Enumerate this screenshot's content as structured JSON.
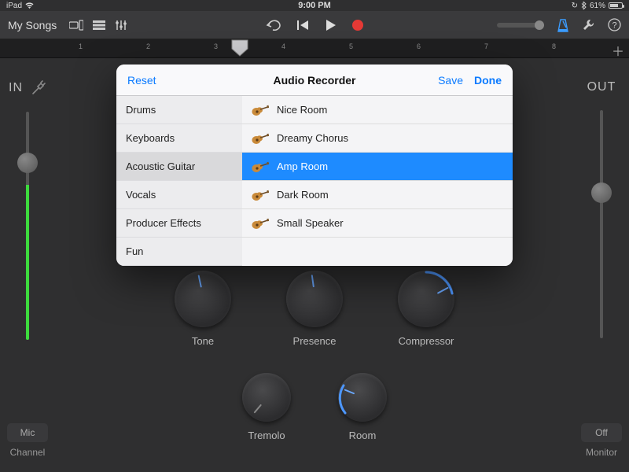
{
  "status": {
    "device": "iPad",
    "time": "9:00 PM",
    "battery_pct": "61%"
  },
  "topbar": {
    "my_songs": "My Songs"
  },
  "ruler": {
    "numbers": [
      1,
      2,
      3,
      4,
      5,
      6,
      7,
      8
    ]
  },
  "sides": {
    "in": {
      "label": "IN",
      "button": "Mic",
      "footer": "Channel"
    },
    "out": {
      "label": "OUT",
      "button": "Off",
      "footer": "Monitor"
    }
  },
  "knobs": {
    "tone": "Tone",
    "presence": "Presence",
    "compressor": "Compressor",
    "tremolo": "Tremolo",
    "room": "Room"
  },
  "modal": {
    "reset": "Reset",
    "title": "Audio Recorder",
    "save": "Save",
    "done": "Done",
    "categories": [
      "Drums",
      "Keyboards",
      "Acoustic Guitar",
      "Vocals",
      "Producer Effects",
      "Fun"
    ],
    "selected_category_index": 2,
    "presets": [
      "Nice Room",
      "Dreamy Chorus",
      "Amp Room",
      "Dark Room",
      "Small Speaker"
    ],
    "selected_preset_index": 2
  }
}
